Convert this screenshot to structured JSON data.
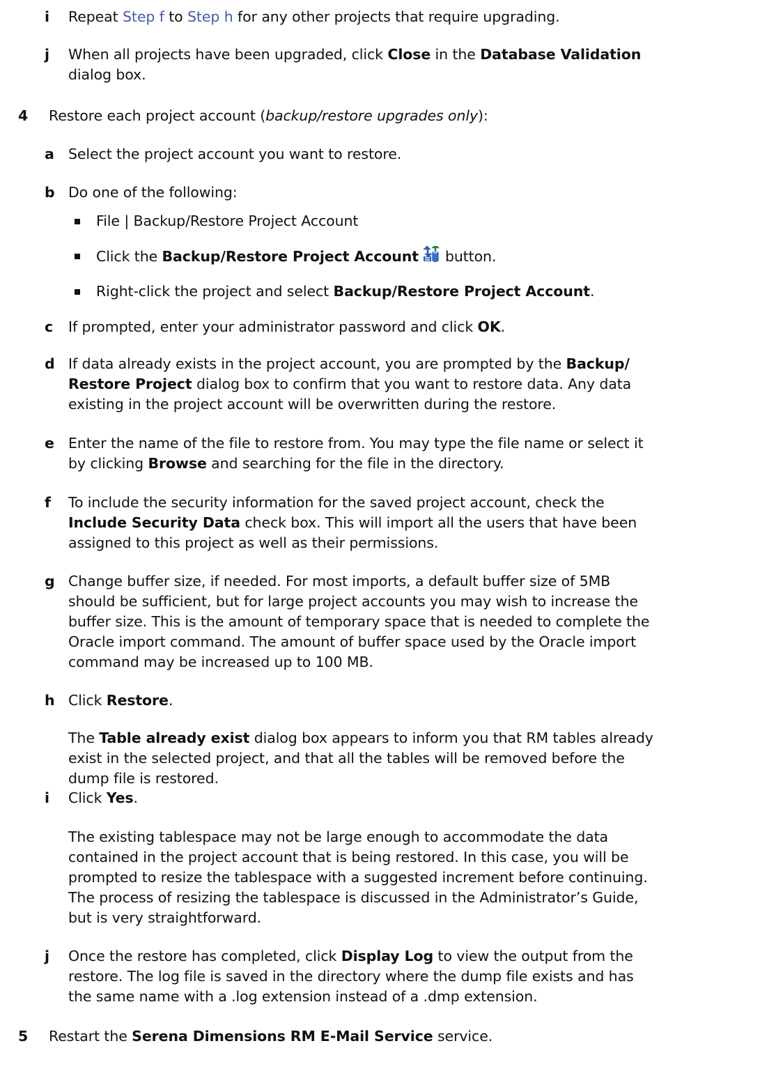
{
  "items": [
    {
      "marker": "i",
      "pre": "Repeat ",
      "link1": "Step f",
      "mid": " to ",
      "link2": "Step h",
      "post": " for any other projects that require upgrading."
    },
    {
      "marker": "j",
      "l1a": "When all projects have been upgraded, click ",
      "l1b": "Close",
      "l1c": " in the ",
      "l1d": "Database Validation",
      "l2": "dialog box."
    },
    {
      "marker": "4",
      "a": "Restore each project account (",
      "b": "backup/restore upgrades only",
      "c": "):"
    },
    {
      "marker": "a",
      "text": "Select the project account you want to restore."
    },
    {
      "marker": "b",
      "text": "Do one of the following:"
    },
    {
      "text": "File | Backup/Restore Project Account"
    },
    {
      "a": "Click the ",
      "b": "Backup/Restore Project Account",
      "c": "button.",
      "icon": "backup-restore-icon"
    },
    {
      "a": "Right-click the project and select ",
      "b": "Backup/Restore Project Account",
      "c": "."
    },
    {
      "marker": "c",
      "a": "If prompted, enter your administrator password and click ",
      "b": "OK",
      "c": "."
    },
    {
      "marker": "d",
      "l1a": "If data already exists in the project account, you are prompted by the ",
      "l1b": "Backup/",
      "l2a": "Restore Project",
      "l2b": " dialog box to confirm that you want to restore data. Any data",
      "l3": "existing in the project account will be overwritten during the restore."
    },
    {
      "marker": "e",
      "l1": "Enter the name of the file to restore from. You may type the file name or select it",
      "l2a": "by clicking ",
      "l2b": "Browse",
      "l2c": " and searching for the file in the directory."
    },
    {
      "marker": "f",
      "l1": "To include the security information for the saved project account, check the",
      "l2a": "Include Security Data",
      "l2b": " check box. This will import all the users that have been",
      "l3": "assigned to this project as well as their permissions."
    },
    {
      "marker": "g",
      "l1": "Change buffer size, if needed. For most imports, a default buffer size of 5MB",
      "l2": "should be sufficient, but for large project accounts you may wish to increase the",
      "l3": "buffer size. This is the amount of temporary space that is needed to complete the",
      "l4": "Oracle import command. The amount of buffer space used by the Oracle import",
      "l5": "command may be increased up to 100 MB."
    },
    {
      "marker": "h",
      "a": "Click ",
      "b": "Restore",
      "c": "."
    },
    {
      "l1a": "The ",
      "l1b": "Table already exist",
      "l1c": " dialog box appears to inform you that RM tables already",
      "l2": "exist in the selected project, and that all the tables will be removed before the",
      "l3": "dump file is restored."
    },
    {
      "marker": "i",
      "a": "Click ",
      "b": "Yes",
      "c": "."
    },
    {
      "l1": "The existing tablespace may not be large enough to accommodate the data",
      "l2": "contained in the project account that is being restored. In this case, you will be",
      "l3": "prompted to resize the tablespace with a suggested increment before continuing.",
      "l4": "The process of resizing the tablespace is discussed in the Administrator’s Guide,",
      "l5": "but is very straightforward."
    },
    {
      "marker": "j",
      "l1a": "Once the restore has completed, click ",
      "l1b": "Display Log",
      "l1c": " to view the output from the",
      "l2": "restore. The log file is saved in the directory where the dump file exists and has",
      "l3": "the same name with a .log extension instead of a .dmp extension."
    },
    {
      "marker": "5",
      "a": "Restart the ",
      "b": "Serena Dimensions RM E-Mail Service",
      "c": " service."
    }
  ]
}
